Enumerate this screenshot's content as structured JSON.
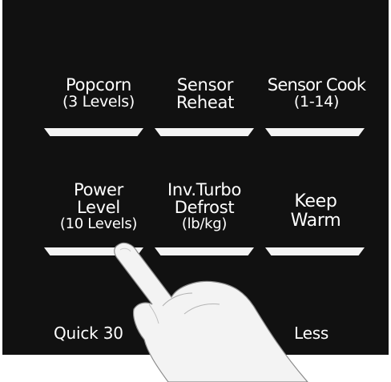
{
  "buttons": {
    "popcorn": {
      "line1": "Popcorn",
      "line2": "(3 Levels)"
    },
    "sensor_reheat": {
      "line1": "Sensor",
      "line2": "Reheat"
    },
    "sensor_cook": {
      "line1": "Sensor Cook",
      "line2": "(1-14)"
    },
    "power_level": {
      "line1": "Power",
      "line2": "Level",
      "line3": "(10 Levels)"
    },
    "inv_turbo_defrost": {
      "line1": "Inv.Turbo",
      "line2": "Defrost",
      "line3": "(lb/kg)"
    },
    "keep_warm": {
      "line1": "Keep",
      "line2": "Warm"
    },
    "quick_30": {
      "label": "Quick 30"
    },
    "less": {
      "label": "Less"
    }
  },
  "colors": {
    "panel": "#111111",
    "text": "#ffffff",
    "button_tab": "#f4f4f4",
    "hand_fill": "#f3f3f3",
    "hand_outline": "#8a8a8a"
  },
  "icons": {
    "pointer": "pointing-hand-icon"
  }
}
